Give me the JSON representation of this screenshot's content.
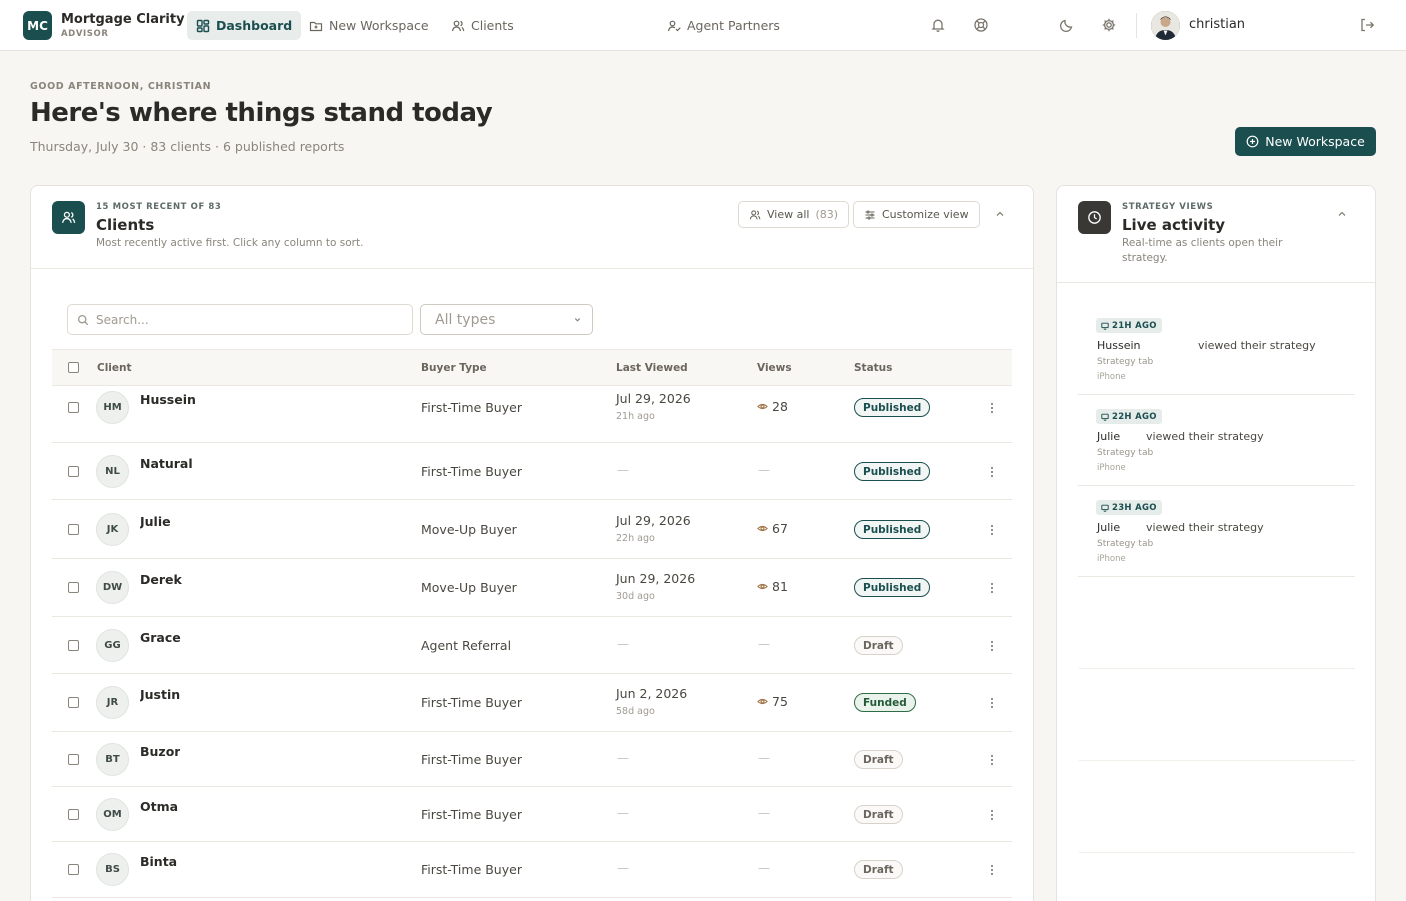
{
  "brand": {
    "initials": "MC",
    "name": "Mortgage Clarity",
    "subtitle": "ADVISOR"
  },
  "nav": {
    "dashboard": "Dashboard",
    "new_workspace": "New Workspace",
    "clients": "Clients",
    "agent_partners": "Agent Partners"
  },
  "user": {
    "name": "christian"
  },
  "hero": {
    "greeting": "GOOD AFTERNOON, CHRISTIAN",
    "title": "Here's where things stand today",
    "subtitle": "Thursday, July 30 · 83 clients · 6 published reports",
    "new_workspace_button": "New Workspace"
  },
  "clients_card": {
    "eyebrow": "15 MOST RECENT OF 83",
    "title": "Clients",
    "description": "Most recently active first. Click any column to sort.",
    "view_all_label": "View all",
    "view_all_count": "(83)",
    "customize_label": "Customize view",
    "search_placeholder": "Search...",
    "type_filter": "All types",
    "columns": {
      "client": "Client",
      "buyer_type": "Buyer Type",
      "last_viewed": "Last Viewed",
      "views": "Views",
      "status": "Status"
    },
    "rows": [
      {
        "initials": "HM",
        "name": "Hussein",
        "buyer_type": "First-Time Buyer",
        "last_viewed": "Jul 29, 2026",
        "ago": "21h ago",
        "views": "28",
        "status": "Published",
        "status_kind": "pub"
      },
      {
        "initials": "NL",
        "name": "Natural",
        "buyer_type": "First-Time Buyer",
        "last_viewed": "—",
        "ago": "",
        "views": "—",
        "status": "Published",
        "status_kind": "pub"
      },
      {
        "initials": "JK",
        "name": "Julie",
        "buyer_type": "Move-Up Buyer",
        "last_viewed": "Jul 29, 2026",
        "ago": "22h ago",
        "views": "67",
        "status": "Published",
        "status_kind": "pub"
      },
      {
        "initials": "DW",
        "name": "Derek",
        "buyer_type": "Move-Up Buyer",
        "last_viewed": "Jun 29, 2026",
        "ago": "30d ago",
        "views": "81",
        "status": "Published",
        "status_kind": "pub"
      },
      {
        "initials": "GG",
        "name": "Grace",
        "buyer_type": "Agent Referral",
        "last_viewed": "—",
        "ago": "",
        "views": "—",
        "status": "Draft",
        "status_kind": "draft"
      },
      {
        "initials": "JR",
        "name": "Justin",
        "buyer_type": "First-Time Buyer",
        "last_viewed": "Jun 2, 2026",
        "ago": "58d ago",
        "views": "75",
        "status": "Funded",
        "status_kind": "funded"
      },
      {
        "initials": "BT",
        "name": "Buzor",
        "buyer_type": "First-Time Buyer",
        "last_viewed": "—",
        "ago": "",
        "views": "—",
        "status": "Draft",
        "status_kind": "draft"
      },
      {
        "initials": "OM",
        "name": "Otma",
        "buyer_type": "First-Time Buyer",
        "last_viewed": "—",
        "ago": "",
        "views": "—",
        "status": "Draft",
        "status_kind": "draft"
      },
      {
        "initials": "BS",
        "name": "Binta",
        "buyer_type": "First-Time Buyer",
        "last_viewed": "—",
        "ago": "",
        "views": "—",
        "status": "Draft",
        "status_kind": "draft"
      }
    ]
  },
  "activity_card": {
    "eyebrow": "STRATEGY VIEWS",
    "title": "Live activity",
    "description": "Real-time as clients open their strategy.",
    "items": [
      {
        "time": "21H AGO",
        "name": "Hussein",
        "action": "viewed their strategy",
        "tab": "Strategy tab",
        "device": "iPhone"
      },
      {
        "time": "22H AGO",
        "name": "Julie",
        "action": "viewed their strategy",
        "tab": "Strategy tab",
        "device": "iPhone"
      },
      {
        "time": "23H AGO",
        "name": "Julie",
        "action": "viewed their strategy",
        "tab": "Strategy tab",
        "device": "iPhone"
      }
    ]
  },
  "colors": {
    "brand": "#1b4e4f",
    "background": "#f7f6f3",
    "funded": "#245a38"
  }
}
